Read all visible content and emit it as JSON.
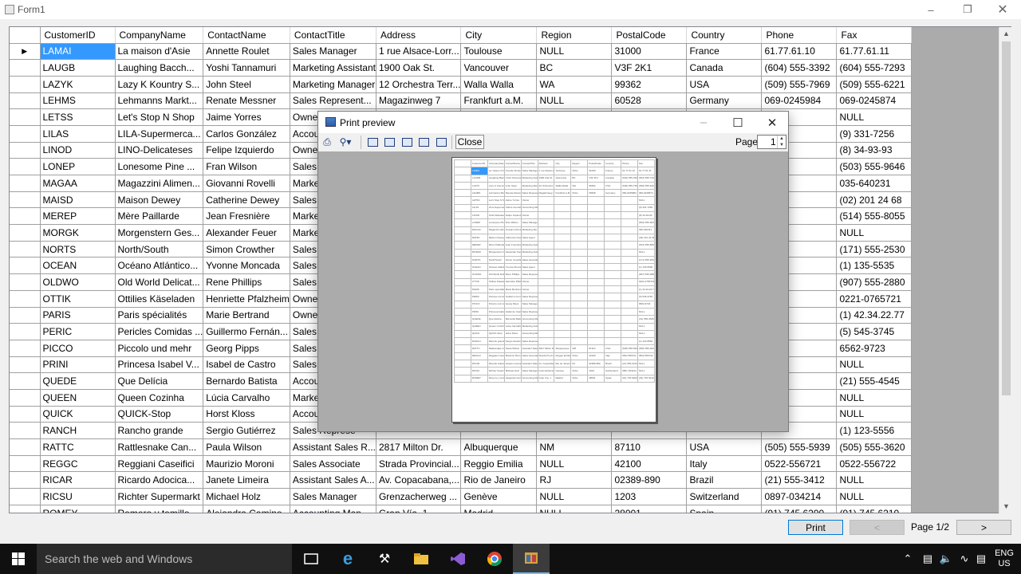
{
  "window": {
    "title": "Form1"
  },
  "grid": {
    "columns": [
      "CustomerID",
      "CompanyName",
      "ContactName",
      "ContactTitle",
      "Address",
      "City",
      "Region",
      "PostalCode",
      "Country",
      "Phone",
      "Fax"
    ],
    "rows": [
      [
        "LAMAI",
        "La maison d'Asie",
        "Annette Roulet",
        "Sales Manager",
        "1 rue Alsace-Lorr...",
        "Toulouse",
        "NULL",
        "31000",
        "France",
        "61.77.61.10",
        "61.77.61.11"
      ],
      [
        "LAUGB",
        "Laughing Bacch...",
        "Yoshi Tannamuri",
        "Marketing Assistant",
        "1900 Oak St.",
        "Vancouver",
        "BC",
        "V3F 2K1",
        "Canada",
        "(604) 555-3392",
        "(604) 555-7293"
      ],
      [
        "LAZYK",
        "Lazy K Kountry S...",
        "John Steel",
        "Marketing Manager",
        "12 Orchestra Terr...",
        "Walla Walla",
        "WA",
        "99362",
        "USA",
        "(509) 555-7969",
        "(509) 555-6221"
      ],
      [
        "LEHMS",
        "Lehmanns Markt...",
        "Renate Messner",
        "Sales Represent...",
        "Magazinweg 7",
        "Frankfurt a.M.",
        "NULL",
        "60528",
        "Germany",
        "069-0245984",
        "069-0245874"
      ],
      [
        "LETSS",
        "Let's Stop N Shop",
        "Jaime Yorres",
        "Owner",
        "",
        "",
        "",
        "",
        "",
        "",
        "NULL"
      ],
      [
        "LILAS",
        "LILA-Supermerca...",
        "Carlos González",
        "Accounting Ma",
        "",
        "",
        "",
        "",
        "",
        "",
        "(9) 331-7256"
      ],
      [
        "LINOD",
        "LINO-Delicateses",
        "Felipe Izquierdo",
        "Owner",
        "",
        "",
        "",
        "",
        "",
        "",
        "(8) 34-93-93"
      ],
      [
        "LONEP",
        "Lonesome Pine ...",
        "Fran Wilson",
        "Sales Manage",
        "",
        "",
        "",
        "",
        "",
        "",
        "(503) 555-9646"
      ],
      [
        "MAGAA",
        "Magazzini Alimen...",
        "Giovanni Rovelli",
        "Marketing Ma",
        "",
        "",
        "",
        "",
        "",
        "",
        "035-640231"
      ],
      [
        "MAISD",
        "Maison Dewey",
        "Catherine Dewey",
        "Sales Agent",
        "",
        "",
        "",
        "",
        "",
        "",
        "(02) 201 24 68"
      ],
      [
        "MEREP",
        "Mère Paillarde",
        "Jean Fresnière",
        "Marketing Assi",
        "",
        "",
        "",
        "",
        "",
        "",
        "(514) 555-8055"
      ],
      [
        "MORGK",
        "Morgenstern Ges...",
        "Alexander Feuer",
        "Marketing Assi",
        "",
        "",
        "",
        "",
        "",
        "",
        "NULL"
      ],
      [
        "NORTS",
        "North/South",
        "Simon Crowther",
        "Sales Associat",
        "",
        "",
        "",
        "",
        "",
        "",
        "(171) 555-2530"
      ],
      [
        "OCEAN",
        "Océano Atlántico...",
        "Yvonne Moncada",
        "Sales Agent",
        "",
        "",
        "",
        "",
        "",
        "",
        "(1) 135-5535"
      ],
      [
        "OLDWO",
        "Old World Delicat...",
        "Rene Phillips",
        "Sales Represe",
        "",
        "",
        "",
        "",
        "",
        "",
        "(907) 555-2880"
      ],
      [
        "OTTIK",
        "Ottilies Käseladen",
        "Henriette Pfalzheim",
        "Owner",
        "",
        "",
        "",
        "",
        "",
        "",
        "0221-0765721"
      ],
      [
        "PARIS",
        "Paris spécialités",
        "Marie Bertrand",
        "Owner",
        "",
        "",
        "",
        "",
        "",
        "",
        "(1) 42.34.22.77"
      ],
      [
        "PERIC",
        "Pericles Comidas ...",
        "Guillermo Fernán...",
        "Sales Represe",
        "",
        "",
        "",
        "",
        "",
        "",
        "(5) 545-3745"
      ],
      [
        "PICCO",
        "Piccolo und mehr",
        "Georg Pipps",
        "Sales Manage",
        "",
        "",
        "",
        "",
        "",
        "",
        "6562-9723"
      ],
      [
        "PRINI",
        "Princesa Isabel V...",
        "Isabel de Castro",
        "Sales Represe",
        "",
        "",
        "",
        "",
        "",
        "",
        "NULL"
      ],
      [
        "QUEDE",
        "Que Delícia",
        "Bernardo Batista",
        "Accounting Ma",
        "",
        "",
        "",
        "",
        "",
        "",
        "(21) 555-4545"
      ],
      [
        "QUEEN",
        "Queen Cozinha",
        "Lúcia Carvalho",
        "Marketing Assi",
        "",
        "",
        "",
        "",
        "",
        "",
        "NULL"
      ],
      [
        "QUICK",
        "QUICK-Stop",
        "Horst Kloss",
        "Accounting Ma",
        "",
        "",
        "",
        "",
        "",
        "",
        "NULL"
      ],
      [
        "RANCH",
        "Rancho grande",
        "Sergio Gutiérrez",
        "Sales Represe",
        "",
        "",
        "",
        "",
        "",
        "",
        "(1) 123-5556"
      ],
      [
        "RATTC",
        "Rattlesnake Can...",
        "Paula Wilson",
        "Assistant Sales R...",
        "2817 Milton Dr.",
        "Albuquerque",
        "NM",
        "87110",
        "USA",
        "(505) 555-5939",
        "(505) 555-3620"
      ],
      [
        "REGGC",
        "Reggiani Caseifici",
        "Maurizio Moroni",
        "Sales Associate",
        "Strada Provincial...",
        "Reggio Emilia",
        "NULL",
        "42100",
        "Italy",
        "0522-556721",
        "0522-556722"
      ],
      [
        "RICAR",
        "Ricardo Adocica...",
        "Janete Limeira",
        "Assistant Sales A...",
        "Av. Copacabana,...",
        "Rio de Janeiro",
        "RJ",
        "02389-890",
        "Brazil",
        "(21) 555-3412",
        "NULL"
      ],
      [
        "RICSU",
        "Richter Supermarkt",
        "Michael Holz",
        "Sales Manager",
        "Grenzacherweg ...",
        "Genève",
        "NULL",
        "1203",
        "Switzerland",
        "0897-034214",
        "NULL"
      ],
      [
        "ROMEY",
        "Romero y tomillo",
        "Alejandra Camino",
        "Accounting Man...",
        "Gran Vía, 1",
        "Madrid",
        "NULL",
        "28001",
        "Spain",
        "(91) 745 6200",
        "(91) 745 6210"
      ]
    ]
  },
  "bottombar": {
    "print_label": "Print",
    "prev_label": "<",
    "next_label": ">",
    "page_text": "Page 1/2"
  },
  "dialog": {
    "title": "Print preview",
    "close_label": "Close",
    "page_label": "Page",
    "page_value": "1"
  },
  "taskbar": {
    "search_placeholder": "Search the web and Windows",
    "lang_top": "ENG",
    "lang_bottom": "US"
  },
  "colors": {
    "selection": "#3399ff",
    "taskbar": "#101010",
    "preview_bg": "#ababab"
  }
}
